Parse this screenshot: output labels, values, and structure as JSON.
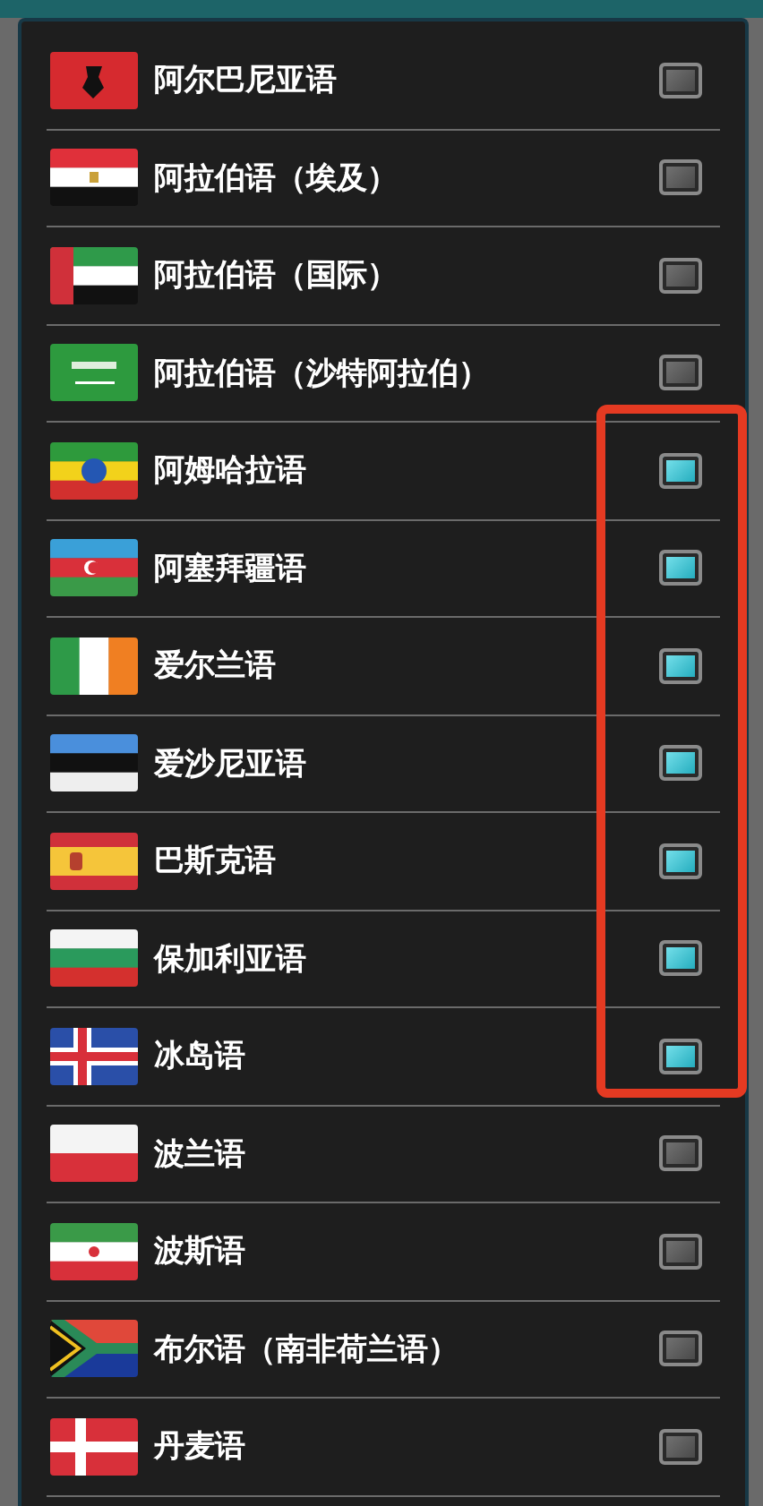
{
  "languages": [
    {
      "name": "阿尔巴尼亚语",
      "checked": false
    },
    {
      "name": "阿拉伯语（埃及）",
      "checked": false
    },
    {
      "name": "阿拉伯语（国际）",
      "checked": false
    },
    {
      "name": "阿拉伯语（沙特阿拉伯）",
      "checked": false
    },
    {
      "name": "阿姆哈拉语",
      "checked": true
    },
    {
      "name": "阿塞拜疆语",
      "checked": true
    },
    {
      "name": "爱尔兰语",
      "checked": true
    },
    {
      "name": "爱沙尼亚语",
      "checked": true
    },
    {
      "name": "巴斯克语",
      "checked": true
    },
    {
      "name": "保加利亚语",
      "checked": true
    },
    {
      "name": "冰岛语",
      "checked": true
    },
    {
      "name": "波兰语",
      "checked": false
    },
    {
      "name": "波斯语",
      "checked": false
    },
    {
      "name": "布尔语（南非荷兰语）",
      "checked": false
    },
    {
      "name": "丹麦语",
      "checked": false
    }
  ]
}
